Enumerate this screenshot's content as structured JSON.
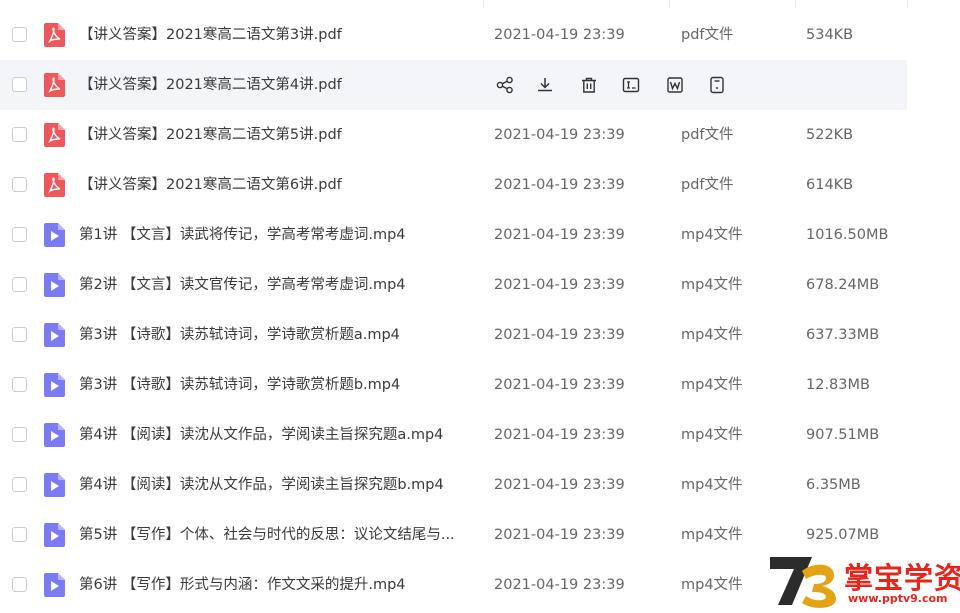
{
  "colors": {
    "pdf_icon": "#f0575a",
    "mp4_icon": "#7b7cf5",
    "row_hover_bg": "#f4f5f8",
    "watermark": "#e8241d",
    "watermark_logo_dark": "#2c2c2c",
    "watermark_logo_gold": "#e3a315"
  },
  "hover_actions": [
    {
      "icon": "share-icon"
    },
    {
      "icon": "download-icon"
    },
    {
      "icon": "delete-icon"
    },
    {
      "icon": "rename-icon"
    },
    {
      "icon": "word-icon"
    },
    {
      "icon": "file-info-icon"
    }
  ],
  "files": [
    {
      "icon": "pdf-file-icon",
      "name": "【讲义答案】2021寒高二语文第3讲.pdf",
      "date": "2021-04-19 23:39",
      "type": "pdf文件",
      "size": "534KB"
    },
    {
      "icon": "pdf-file-icon",
      "name": "【讲义答案】2021寒高二语文第4讲.pdf",
      "date": "",
      "type": "",
      "size": "",
      "hovered": true
    },
    {
      "icon": "pdf-file-icon",
      "name": "【讲义答案】2021寒高二语文第5讲.pdf",
      "date": "2021-04-19 23:39",
      "type": "pdf文件",
      "size": "522KB"
    },
    {
      "icon": "pdf-file-icon",
      "name": "【讲义答案】2021寒高二语文第6讲.pdf",
      "date": "2021-04-19 23:39",
      "type": "pdf文件",
      "size": "614KB"
    },
    {
      "icon": "mp4-file-icon",
      "name": "第1讲 【文言】读武将传记，学高考常考虚词.mp4",
      "date": "2021-04-19 23:39",
      "type": "mp4文件",
      "size": "1016.50MB"
    },
    {
      "icon": "mp4-file-icon",
      "name": "第2讲 【文言】读文官传记，学高考常考虚词.mp4",
      "date": "2021-04-19 23:39",
      "type": "mp4文件",
      "size": "678.24MB"
    },
    {
      "icon": "mp4-file-icon",
      "name": "第3讲 【诗歌】读苏轼诗词，学诗歌赏析题a.mp4",
      "date": "2021-04-19 23:39",
      "type": "mp4文件",
      "size": "637.33MB"
    },
    {
      "icon": "mp4-file-icon",
      "name": "第3讲 【诗歌】读苏轼诗词，学诗歌赏析题b.mp4",
      "date": "2021-04-19 23:39",
      "type": "mp4文件",
      "size": "12.83MB"
    },
    {
      "icon": "mp4-file-icon",
      "name": "第4讲 【阅读】读沈从文作品，学阅读主旨探究题a.mp4",
      "date": "2021-04-19 23:39",
      "type": "mp4文件",
      "size": "907.51MB"
    },
    {
      "icon": "mp4-file-icon",
      "name": "第4讲 【阅读】读沈从文作品，学阅读主旨探究题b.mp4",
      "date": "2021-04-19 23:39",
      "type": "mp4文件",
      "size": "6.35MB"
    },
    {
      "icon": "mp4-file-icon",
      "name": "第5讲 【写作】个体、社会与时代的反思：议论文结尾与...",
      "date": "2021-04-19 23:39",
      "type": "mp4文件",
      "size": "925.07MB"
    },
    {
      "icon": "mp4-file-icon",
      "name": "第6讲 【写作】形式与内涵：作文文采的提升.mp4",
      "date": "2021-04-19 23:39",
      "type": "mp4文件",
      "size": ""
    }
  ],
  "watermark": {
    "logo_icon": "pptv9-logo-icon",
    "title": "掌宝学资网",
    "url": "www.pptv9.com"
  }
}
